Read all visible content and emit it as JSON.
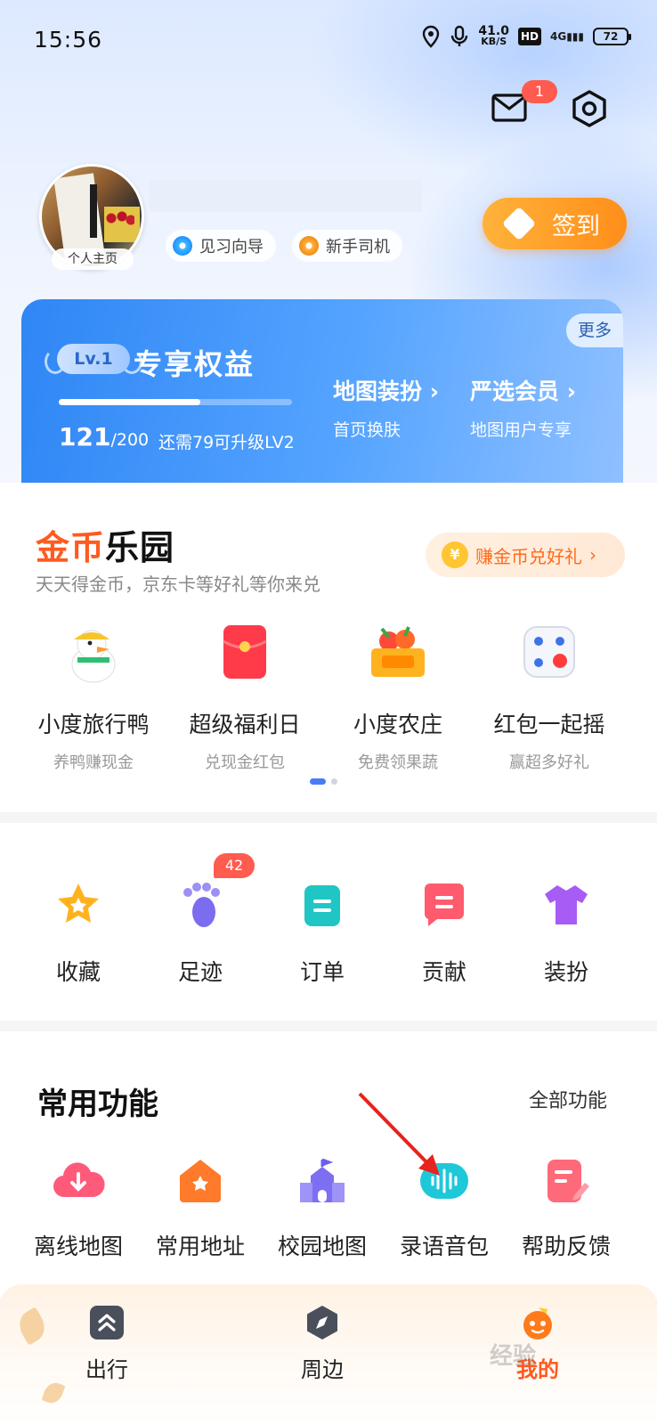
{
  "status_bar": {
    "time": "15:56",
    "net_speed": "41.0",
    "net_unit": "KB/S",
    "hd": "HD",
    "signal": "4G",
    "battery": "72"
  },
  "header": {
    "mail_badge": "1"
  },
  "profile": {
    "avatar_label": "个人主页",
    "tags": [
      "见习向导",
      "新手司机"
    ],
    "signin_label": "签到"
  },
  "member_card": {
    "level": "Lv.1",
    "title": "专享权益",
    "more": "更多",
    "progress_fraction": 0.605,
    "points_current": "121",
    "points_total": "/200",
    "upgrade_hint": "还需79可升级LV2",
    "perks": [
      {
        "title": "地图装扮",
        "sub": "首页换肤"
      },
      {
        "title": "严选会员",
        "sub": "地图用户专享"
      }
    ]
  },
  "coin_park": {
    "logo_a": "金币",
    "logo_b": "乐园",
    "subtitle": "天天得金币，京东卡等好礼等你来兑",
    "earn_label": "赚金币兑好礼",
    "earn_icon": "¥",
    "items": [
      {
        "label": "小度旅行鸭",
        "sub": "养鸭赚现金",
        "icon": "duck-icon"
      },
      {
        "label": "超级福利日",
        "sub": "兑现金红包",
        "icon": "red-envelope-icon"
      },
      {
        "label": "小度农庄",
        "sub": "免费领果蔬",
        "icon": "fruit-basket-icon"
      },
      {
        "label": "红包一起摇",
        "sub": "赢超多好礼",
        "icon": "dice-icon"
      }
    ]
  },
  "quick_links": {
    "items": [
      {
        "label": "收藏",
        "icon": "star-icon"
      },
      {
        "label": "足迹",
        "icon": "footprint-icon"
      },
      {
        "label": "订单",
        "icon": "order-icon"
      },
      {
        "label": "贡献",
        "icon": "contribution-icon"
      },
      {
        "label": "装扮",
        "icon": "tshirt-icon"
      }
    ],
    "footprint_badge": "42"
  },
  "functions": {
    "title": "常用功能",
    "all_label": "全部功能",
    "items": [
      {
        "label": "离线地图",
        "icon": "cloud-download-icon"
      },
      {
        "label": "常用地址",
        "icon": "home-icon"
      },
      {
        "label": "校园地图",
        "icon": "school-icon"
      },
      {
        "label": "录语音包",
        "icon": "voice-wave-icon"
      },
      {
        "label": "帮助反馈",
        "icon": "feedback-icon"
      }
    ]
  },
  "bottom_nav": {
    "items": [
      {
        "label": "出行",
        "icon": "travel-icon"
      },
      {
        "label": "周边",
        "icon": "compass-icon"
      },
      {
        "label": "我的",
        "icon": "mascot-icon"
      }
    ],
    "active": "我的"
  },
  "watermark": "经验",
  "colors": {
    "accent_orange": "#ff8e1a",
    "card_blue": "#2f86f5",
    "badge_red": "#ff5b4f",
    "active_tab": "#ff5a1f"
  }
}
